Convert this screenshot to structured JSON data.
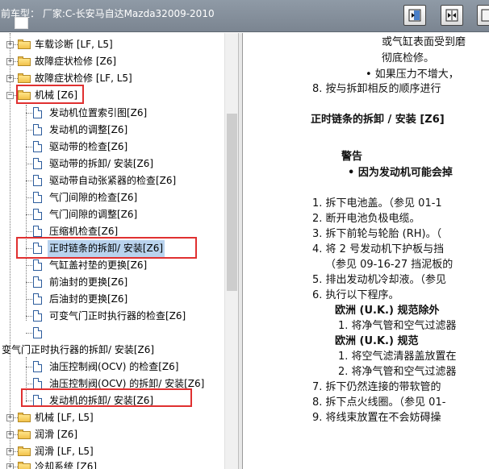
{
  "window": {
    "title": "前车型：  厂家:C-长安马自达Mazda32009-2010"
  },
  "tree": {
    "items": [
      {
        "label": "车载诊断 [LF, L5]"
      },
      {
        "label": "故障症状检修 [Z6]"
      },
      {
        "label": "故障症状检修 [LF, L5]"
      },
      {
        "label": "机械 [Z6]"
      },
      {
        "label": "发动机位置索引图[Z6]"
      },
      {
        "label": "发动机的调整[Z6]"
      },
      {
        "label": "驱动带的检查[Z6]"
      },
      {
        "label": "驱动带的拆卸/ 安装[Z6]"
      },
      {
        "label": "驱动带自动张紧器的检查[Z6]"
      },
      {
        "label": "气门间隙的检查[Z6]"
      },
      {
        "label": "气门间隙的调整[Z6]"
      },
      {
        "label": "压缩机检查[Z6]"
      },
      {
        "label": "正时链条的拆卸/ 安装[Z6]"
      },
      {
        "label": "气缸盖衬垫的更换[Z6]"
      },
      {
        "label": "前油封的更换[Z6]"
      },
      {
        "label": "后油封的更换[Z6]"
      },
      {
        "label": "可变气门正时执行器的检查[Z6]"
      },
      {
        "label": ""
      },
      {
        "label": "变气门正时执行器的拆卸/ 安装[Z6]"
      },
      {
        "label": "油压控制阀(OCV) 的检查[Z6]"
      },
      {
        "label": "油压控制阀(OCV) 的拆卸/ 安装[Z6]"
      },
      {
        "label": "发动机的拆卸/ 安装[Z6]"
      },
      {
        "label": "机械 [LF, L5]"
      },
      {
        "label": "润滑 [Z6]"
      },
      {
        "label": "润滑 [LF, L5]"
      },
      {
        "label": "冷却系统 [Z6]"
      }
    ]
  },
  "document": {
    "lines": [
      {
        "text": "或气缸表面受到磨"
      },
      {
        "text": "彻底检修。"
      },
      {
        "text": "•  如果压力不增大，"
      },
      {
        "text": "8.  按与拆卸相反的顺序进行"
      },
      {
        "text": "正时链条的拆卸 / 安装 [Z6]"
      },
      {
        "text": "警告"
      },
      {
        "text": "•  因为发动机可能会掉"
      },
      {
        "text": "1.  拆下电池盖。（参见 01-1"
      },
      {
        "text": "2.  断开电池负极电缆。"
      },
      {
        "text": "3.  拆下前轮与轮胎 (RH)。（"
      },
      {
        "text": "4.  将 2 号发动机下护板与挡"
      },
      {
        "text": "（参见 09-16-27 挡泥板的"
      },
      {
        "text": "5.  排出发动机冷却液。（参见"
      },
      {
        "text": "6.  执行以下程序。"
      },
      {
        "text": "欧洲 (U.K.) 规范除外"
      },
      {
        "text": "1.  将净气管和空气过滤器"
      },
      {
        "text": "欧洲 (U.K.) 规范"
      },
      {
        "text": "1.  将空气滤清器盖放置在"
      },
      {
        "text": "2.  将净气管和空气过滤器"
      },
      {
        "text": "7.  拆下仍然连接的带软管的"
      },
      {
        "text": "8.  拆下点火线圈。（参见 01-"
      },
      {
        "text": "9.  将线束放置在不会妨碍操"
      }
    ]
  },
  "icons": {
    "toolbar": [
      "panel-right-icon",
      "collapse-horizontal-icon",
      "panel-left-icon"
    ]
  }
}
